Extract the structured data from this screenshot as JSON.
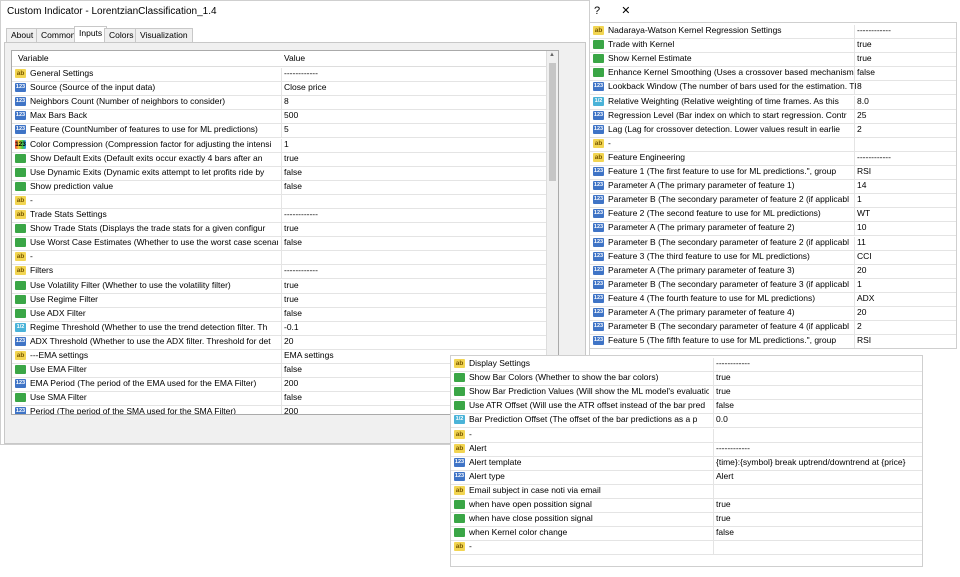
{
  "window": {
    "title": "Custom Indicator - LorentzianClassification_1.4",
    "help": "?",
    "close": "✕"
  },
  "tabs": [
    "About",
    "Common",
    "Inputs",
    "Colors",
    "Visualization"
  ],
  "active_tab": "Inputs",
  "grid": {
    "col_variable": "Variable",
    "col_value": "Value",
    "rows": [
      {
        "icon": "ab",
        "var": "General Settings",
        "val": "------------"
      },
      {
        "icon": "123",
        "var": "Source (Source of the input data)",
        "val": "Close price"
      },
      {
        "icon": "123",
        "var": "Neighbors Count (Number of neighbors to consider)",
        "val": "8"
      },
      {
        "icon": "123",
        "var": "Max Bars Back",
        "val": "500"
      },
      {
        "icon": "123",
        "var": "Feature (CountNumber of features to use for ML predictions)",
        "val": "5"
      },
      {
        "icon": "123",
        "var": "Color Compression (Compression factor for adjusting the intensi",
        "val": "1"
      },
      {
        "icon": "bool",
        "var": "Show Default Exits (Default exits occur exactly 4 bars after an",
        "val": "true"
      },
      {
        "icon": "bool",
        "var": "Use Dynamic Exits (Dynamic exits attempt to let profits ride by",
        "val": "false"
      },
      {
        "icon": "bool",
        "var": "Show prediction value",
        "val": "false"
      },
      {
        "icon": "ab",
        "var": "-",
        "val": ""
      },
      {
        "icon": "ab",
        "var": "Trade Stats Settings",
        "val": "------------"
      },
      {
        "icon": "bool",
        "var": "Show Trade Stats (Displays the trade stats for a given configur",
        "val": "true"
      },
      {
        "icon": "bool",
        "var": "Use Worst Case Estimates (Whether to use the worst case scenari",
        "val": "false"
      },
      {
        "icon": "ab",
        "var": "-",
        "val": ""
      },
      {
        "icon": "ab",
        "var": "Filters",
        "val": "------------"
      },
      {
        "icon": "bool",
        "var": "Use Volatility Filter (Whether to use the volatility filter)",
        "val": "true"
      },
      {
        "icon": "bool",
        "var": "Use Regime Filter",
        "val": "true"
      },
      {
        "icon": "bool",
        "var": "Use ADX Filter",
        "val": "false"
      },
      {
        "icon": "dbl",
        "var": "Regime Threshold (Whether to use the trend detection filter. Th",
        "val": "-0.1"
      },
      {
        "icon": "123",
        "var": "ADX Threshold (Whether to use the ADX filter. Threshold for det",
        "val": "20"
      },
      {
        "icon": "ab",
        "var": "---EMA settings",
        "val": "EMA settings"
      },
      {
        "icon": "bool",
        "var": "Use EMA Filter",
        "val": "false"
      },
      {
        "icon": "123",
        "var": "EMA Period (The period of the EMA used for the EMA Filter)",
        "val": "200"
      },
      {
        "icon": "bool",
        "var": "Use SMA Filter",
        "val": "false"
      },
      {
        "icon": "123",
        "var": "Period (The period of the SMA used for the SMA Filter)",
        "val": "200"
      }
    ]
  },
  "panel_kernel": {
    "rows": [
      {
        "icon": "ab",
        "var": "Nadaraya-Watson Kernel Regression Settings",
        "val": "------------"
      },
      {
        "icon": "bool",
        "var": "Trade with Kernel",
        "val": "true"
      },
      {
        "icon": "bool",
        "var": "Show Kernel Estimate",
        "val": "true"
      },
      {
        "icon": "bool",
        "var": "Enhance Kernel Smoothing (Uses a crossover based mechanism to s",
        "val": "false"
      },
      {
        "icon": "123",
        "var": "Lookback Window (The number of bars used for the estimation. Th",
        "val": "8"
      },
      {
        "icon": "dbl",
        "var": "Relative Weighting (Relative weighting of time frames. As this",
        "val": "8.0"
      },
      {
        "icon": "123",
        "var": "Regression Level (Bar index on which to start regression. Contr",
        "val": "25"
      },
      {
        "icon": "123",
        "var": "Lag (Lag for crossover detection. Lower values result in earlie",
        "val": "2"
      },
      {
        "icon": "ab",
        "var": "-",
        "val": ""
      },
      {
        "icon": "ab",
        "var": "Feature Engineering",
        "val": "------------"
      },
      {
        "icon": "123",
        "var": "Feature 1 (The first feature to use for ML predictions.\", group",
        "val": "RSI"
      },
      {
        "icon": "123",
        "var": "Parameter A (The primary parameter of feature 1)",
        "val": "14"
      },
      {
        "icon": "123",
        "var": "Parameter B (The secondary parameter of feature 2 (if applicabl",
        "val": "1"
      },
      {
        "icon": "123",
        "var": "Feature 2 (The second feature to use for ML predictions)",
        "val": "WT"
      },
      {
        "icon": "123",
        "var": "Parameter A (The primary parameter of feature 2)",
        "val": "10"
      },
      {
        "icon": "123",
        "var": "Parameter B (The secondary parameter of feature 2 (if applicabl",
        "val": "11"
      },
      {
        "icon": "123",
        "var": "Feature 3 (The third feature to use for ML predictions)",
        "val": "CCI"
      },
      {
        "icon": "123",
        "var": "Parameter A (The primary parameter of feature 3)",
        "val": "20"
      },
      {
        "icon": "123",
        "var": "Parameter B (The secondary parameter of feature 3 (if applicabl",
        "val": "1"
      },
      {
        "icon": "123",
        "var": "Feature 4 (The fourth feature to use for ML predictions)",
        "val": "ADX"
      },
      {
        "icon": "123",
        "var": "Parameter A (The primary parameter of feature 4)",
        "val": "20"
      },
      {
        "icon": "123",
        "var": "Parameter B (The secondary parameter of feature 4 (if applicabl",
        "val": "2"
      },
      {
        "icon": "123",
        "var": "Feature 5 (The fifth feature to use for ML predictions.\", group",
        "val": "RSI"
      }
    ]
  },
  "panel_display": {
    "rows": [
      {
        "icon": "ab",
        "var": "Display Settings",
        "val": "------------"
      },
      {
        "icon": "bool",
        "var": "Show Bar Colors (Whether to show the bar colors)",
        "val": "true"
      },
      {
        "icon": "bool",
        "var": "Show Bar Prediction Values (Will show the ML model's evaluation",
        "val": "true"
      },
      {
        "icon": "bool",
        "var": "Use ATR Offset (Will use the ATR offset instead of the bar pred",
        "val": "false"
      },
      {
        "icon": "dbl",
        "var": "Bar Prediction Offset (The offset of the bar predictions as a p",
        "val": "0.0"
      },
      {
        "icon": "ab",
        "var": "-",
        "val": ""
      },
      {
        "icon": "ab",
        "var": "Alert",
        "val": "------------"
      },
      {
        "icon": "123",
        "var": "Alert template",
        "val": "{time}:{symbol} break uptrend/downtrend at {price}"
      },
      {
        "icon": "123",
        "var": "Alert type",
        "val": "Alert"
      },
      {
        "icon": "ab",
        "var": "Email subject in case noti via email",
        "val": ""
      },
      {
        "icon": "bool",
        "var": "when have open possition signal",
        "val": "true"
      },
      {
        "icon": "bool",
        "var": "when have close possition signal",
        "val": "true"
      },
      {
        "icon": "bool",
        "var": "when Kernel color change",
        "val": "false"
      },
      {
        "icon": "ab",
        "var": "-",
        "val": ""
      }
    ]
  }
}
